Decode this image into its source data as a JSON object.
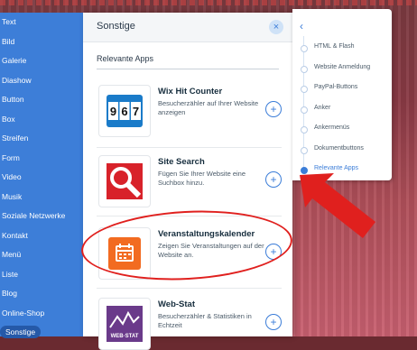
{
  "sidebar": {
    "items": [
      {
        "label": "Text"
      },
      {
        "label": "Bild"
      },
      {
        "label": "Galerie"
      },
      {
        "label": "Diashow"
      },
      {
        "label": "Button"
      },
      {
        "label": "Box"
      },
      {
        "label": "Streifen"
      },
      {
        "label": "Form"
      },
      {
        "label": "Video"
      },
      {
        "label": "Musik"
      },
      {
        "label": "Soziale Netzwerke"
      },
      {
        "label": "Kontakt"
      },
      {
        "label": "Menü"
      },
      {
        "label": "Liste"
      },
      {
        "label": "Blog"
      },
      {
        "label": "Online-Shop"
      },
      {
        "label": "Sonstige"
      }
    ]
  },
  "panel": {
    "title": "Sonstige",
    "close_icon": "×",
    "section_title": "Relevante Apps",
    "apps": [
      {
        "name": "Wix Hit Counter",
        "desc": "Besucherzähler auf Ihrer Website anzeigen",
        "icon": "hit-counter-icon",
        "counter_digits": [
          "9",
          "6",
          "7"
        ],
        "add_icon": "+"
      },
      {
        "name": "Site Search",
        "desc": "Fügen Sie Ihrer Website eine Suchbox hinzu.",
        "icon": "site-search-icon",
        "add_icon": "+"
      },
      {
        "name": "Veranstaltungskalender",
        "desc": "Zeigen Sie Veranstaltungen auf der Website an.",
        "icon": "calendar-icon",
        "add_icon": "+"
      },
      {
        "name": "Web-Stat",
        "desc": "Besucherzähler & Statistiken in Echtzeit",
        "icon": "web-stat-icon",
        "icon_text": "WEB·STAT",
        "add_icon": "+"
      }
    ]
  },
  "nav": {
    "back_icon": "‹",
    "items": [
      {
        "label": "HTML & Flash"
      },
      {
        "label": "Website Anmeldung"
      },
      {
        "label": "PayPal-Buttons"
      },
      {
        "label": "Anker"
      },
      {
        "label": "Ankermenüs"
      },
      {
        "label": "Dokumentbuttons"
      },
      {
        "label": "Relevante Apps",
        "active": true
      }
    ]
  },
  "colors": {
    "sidebar_bg": "#3d7ed8",
    "accent": "#3b7dd8",
    "annotation_red": "#e0201e"
  }
}
